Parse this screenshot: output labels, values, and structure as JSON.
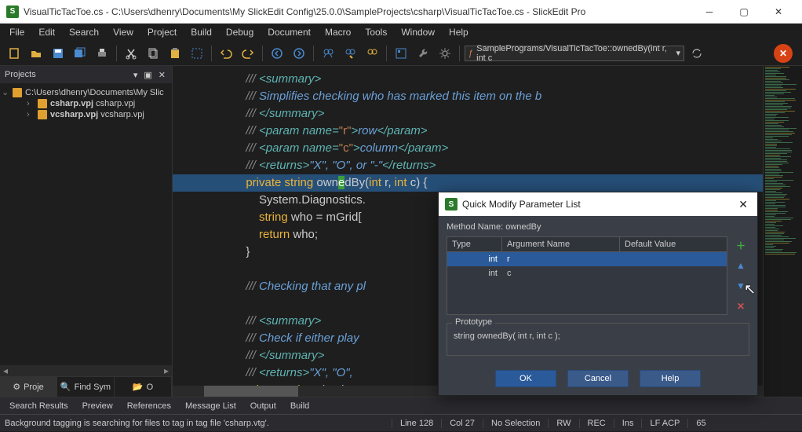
{
  "title_bar": {
    "app_icon": "S",
    "title": "VisualTicTacToe.cs - C:\\Users\\dhenry\\Documents\\My SlickEdit Config\\25.0.0\\SampleProjects\\csharp\\VisualTicTacToe.cs - SlickEdit Pro"
  },
  "menu": [
    "File",
    "Edit",
    "Search",
    "View",
    "Project",
    "Build",
    "Debug",
    "Document",
    "Macro",
    "Tools",
    "Window",
    "Help"
  ],
  "toolbar_dropdown": {
    "icon": "ƒ",
    "text": "SamplePrograms/VisualTicTacToe::ownedBy(int r, int c"
  },
  "projects": {
    "title": "Projects",
    "root": "C:\\Users\\dhenry\\Documents\\My Slic",
    "items": [
      {
        "bold": "csharp.vpj",
        "rest": "csharp.vpj"
      },
      {
        "bold": "vcsharp.vpj",
        "rest": "vcsharp.vpj"
      }
    ],
    "tabs": [
      {
        "icon": "⚙",
        "label": "Proje"
      },
      {
        "icon": "🔍",
        "label": "Find Sym"
      },
      {
        "icon": "📂",
        "label": "O"
      }
    ]
  },
  "code": {
    "lines": [
      {
        "t": "doc",
        "html": "/// <span class='c-tag'>&lt;summary&gt;</span>"
      },
      {
        "t": "doc",
        "html": "/// <span class='c-doc'>Simplifies checking who has marked this item on the b</span>"
      },
      {
        "t": "doc",
        "html": "/// <span class='c-tag'>&lt;/summary&gt;</span>"
      },
      {
        "t": "doc",
        "html": "/// <span class='c-tag'>&lt;param name=</span><span class='c-str'>\"r\"</span><span class='c-tag'>&gt;</span><span class='c-doc'>row</span><span class='c-tag'>&lt;/param&gt;</span>"
      },
      {
        "t": "doc",
        "html": "/// <span class='c-tag'>&lt;param name=</span><span class='c-str'>\"c\"</span><span class='c-tag'>&gt;</span><span class='c-doc'>column</span><span class='c-tag'>&lt;/param&gt;</span>"
      },
      {
        "t": "doc",
        "html": "/// <span class='c-tag'>&lt;returns&gt;</span><span class='c-doc'>\"X\", \"O\", or \"-\"</span><span class='c-tag'>&lt;/returns&gt;</span>"
      },
      {
        "t": "code",
        "hl": true,
        "html": "<span class='c-kw'>private</span> <span class='c-type'>string</span> <span class='c-ident'>own</span><span class='cursor-mark'>e</span><span class='c-ident'>dBy</span><span class='c-punc'>(</span><span class='c-type'>int</span> <span class='c-ident'>r</span><span class='c-punc'>,</span> <span class='c-type'>int</span> <span class='c-ident'>c</span><span class='c-punc'>) {</span>"
      },
      {
        "t": "code",
        "html": "    <span class='c-ident'>System.Diagnostics.</span>"
      },
      {
        "t": "code",
        "html": "    <span class='c-type'>string</span> <span class='c-ident'>who</span> <span class='c-punc'>=</span> <span class='c-ident'>mGrid[</span>"
      },
      {
        "t": "code",
        "html": "    <span class='c-kw'>return</span> <span class='c-ident'>who</span><span class='c-punc'>;</span>"
      },
      {
        "t": "code",
        "html": "<span class='c-punc'>}</span>"
      },
      {
        "t": "blank",
        "html": ""
      },
      {
        "t": "doc",
        "html": "/// <span class='c-doc'>Checking that any pl</span>"
      },
      {
        "t": "blank",
        "html": ""
      },
      {
        "t": "doc",
        "html": "/// <span class='c-tag'>&lt;summary&gt;</span>"
      },
      {
        "t": "doc",
        "html": "/// <span class='c-doc'>Check if either play</span>"
      },
      {
        "t": "doc",
        "html": "/// <span class='c-tag'>&lt;/summary&gt;</span>"
      },
      {
        "t": "doc",
        "html": "/// <span class='c-tag'>&lt;returns&gt;</span><span class='c-doc'>\"X\", \"O\", </span>"
      },
      {
        "t": "code",
        "html": "<span class='c-kw'>private</span> <span class='c-type'>string</span> <span class='c-ident'>checkForW</span>"
      }
    ]
  },
  "dialog": {
    "title": "Quick Modify Parameter List",
    "method_label": "Method Name:",
    "method_name": "ownedBy",
    "cols": {
      "type": "Type",
      "arg": "Argument Name",
      "def": "Default Value"
    },
    "rows": [
      {
        "type": "int",
        "name": "r",
        "sel": true
      },
      {
        "type": "int",
        "name": "c",
        "sel": false
      }
    ],
    "proto_label": "Prototype",
    "proto_text": "string ownedBy( int r, int c );",
    "buttons": {
      "ok": "OK",
      "cancel": "Cancel",
      "help": "Help"
    }
  },
  "bottom_tabs": [
    "Search Results",
    "Preview",
    "References",
    "Message List",
    "Output",
    "Build"
  ],
  "status": {
    "msg": "Background tagging is searching for files to tag in tag file 'csharp.vtg'.",
    "line": "Line 128",
    "col": "Col 27",
    "sel": "No Selection",
    "rw": "RW",
    "rec": "REC",
    "ins": "Ins",
    "enc": "LF ACP",
    "num": "65"
  }
}
